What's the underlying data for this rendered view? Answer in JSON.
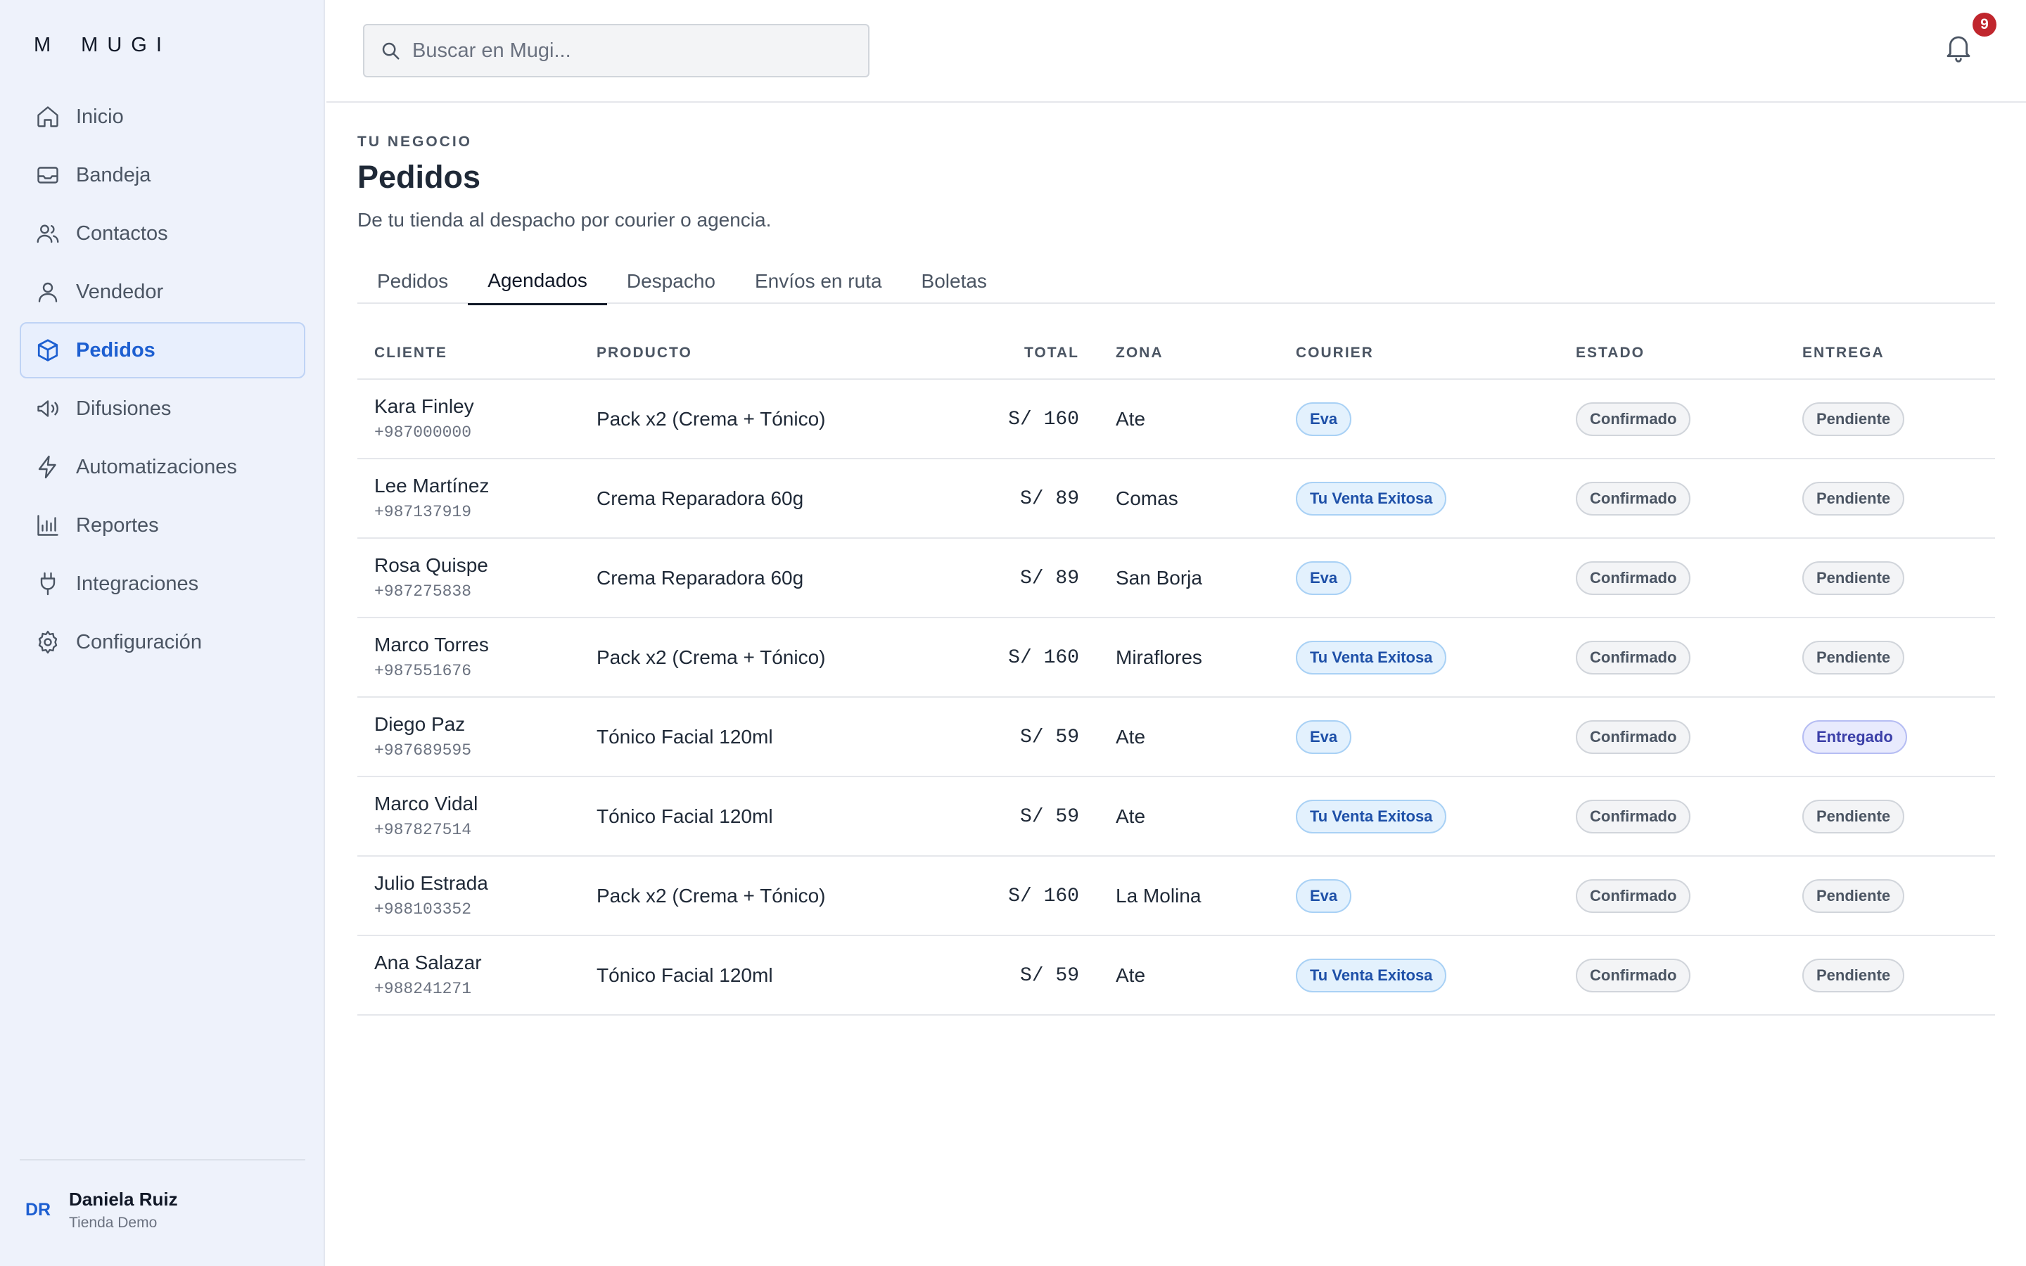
{
  "app": {
    "logo_mark": "M",
    "logo_text": "MUGI"
  },
  "sidebar": {
    "items": [
      {
        "label": "Inicio",
        "icon": "home-icon"
      },
      {
        "label": "Bandeja",
        "icon": "inbox-icon"
      },
      {
        "label": "Contactos",
        "icon": "users-icon"
      },
      {
        "label": "Vendedor",
        "icon": "user-icon"
      },
      {
        "label": "Pedidos",
        "icon": "box-icon",
        "active": true
      },
      {
        "label": "Difusiones",
        "icon": "megaphone-icon"
      },
      {
        "label": "Automatizaciones",
        "icon": "bolt-icon"
      },
      {
        "label": "Reportes",
        "icon": "bar-chart-icon"
      },
      {
        "label": "Integraciones",
        "icon": "plug-icon"
      },
      {
        "label": "Configuración",
        "icon": "gear-icon"
      }
    ],
    "user": {
      "initials": "DR",
      "name": "Daniela Ruiz",
      "store": "Tienda Demo"
    }
  },
  "topbar": {
    "search_placeholder": "Buscar en Mugi...",
    "notifications_count": "9"
  },
  "page": {
    "eyebrow": "TU NEGOCIO",
    "title": "Pedidos",
    "subtitle": "De tu tienda al despacho por courier o agencia."
  },
  "tabs": [
    {
      "label": "Pedidos"
    },
    {
      "label": "Agendados",
      "active": true
    },
    {
      "label": "Despacho"
    },
    {
      "label": "Envíos en ruta"
    },
    {
      "label": "Boletas"
    }
  ],
  "table": {
    "headers": {
      "cliente": "CLIENTE",
      "producto": "PRODUCTO",
      "total": "TOTAL",
      "zona": "ZONA",
      "courier": "COURIER",
      "estado": "ESTADO",
      "entrega": "ENTREGA"
    },
    "rows": [
      {
        "name": "Kara Finley",
        "phone": "+987000000",
        "product": "Pack x2 (Crema + Tónico)",
        "total": "S/ 160",
        "zona": "Ate",
        "courier": "Eva",
        "estado": "Confirmado",
        "entrega": "Pendiente"
      },
      {
        "name": "Lee Martínez",
        "phone": "+987137919",
        "product": "Crema Reparadora 60g",
        "total": "S/ 89",
        "zona": "Comas",
        "courier": "Tu Venta Exitosa",
        "estado": "Confirmado",
        "entrega": "Pendiente"
      },
      {
        "name": "Rosa Quispe",
        "phone": "+987275838",
        "product": "Crema Reparadora 60g",
        "total": "S/ 89",
        "zona": "San Borja",
        "courier": "Eva",
        "estado": "Confirmado",
        "entrega": "Pendiente"
      },
      {
        "name": "Marco Torres",
        "phone": "+987551676",
        "product": "Pack x2 (Crema + Tónico)",
        "total": "S/ 160",
        "zona": "Miraflores",
        "courier": "Tu Venta Exitosa",
        "estado": "Confirmado",
        "entrega": "Pendiente"
      },
      {
        "name": "Diego Paz",
        "phone": "+987689595",
        "product": "Tónico Facial 120ml",
        "total": "S/ 59",
        "zona": "Ate",
        "courier": "Eva",
        "estado": "Confirmado",
        "entrega": "Entregado"
      },
      {
        "name": "Marco Vidal",
        "phone": "+987827514",
        "product": "Tónico Facial 120ml",
        "total": "S/ 59",
        "zona": "Ate",
        "courier": "Tu Venta Exitosa",
        "estado": "Confirmado",
        "entrega": "Pendiente"
      },
      {
        "name": "Julio Estrada",
        "phone": "+988103352",
        "product": "Pack x2 (Crema + Tónico)",
        "total": "S/ 160",
        "zona": "La Molina",
        "courier": "Eva",
        "estado": "Confirmado",
        "entrega": "Pendiente"
      },
      {
        "name": "Ana Salazar",
        "phone": "+988241271",
        "product": "Tónico Facial 120ml",
        "total": "S/ 59",
        "zona": "Ate",
        "courier": "Tu Venta Exitosa",
        "estado": "Confirmado",
        "entrega": "Pendiente"
      }
    ]
  },
  "colors": {
    "accent": "#1d5fd1",
    "sidebar_bg": "#eef2fb",
    "badge": "#c0262d",
    "courier_pill": "#e3f1fd",
    "delivered_pill": "#e8eafd"
  }
}
